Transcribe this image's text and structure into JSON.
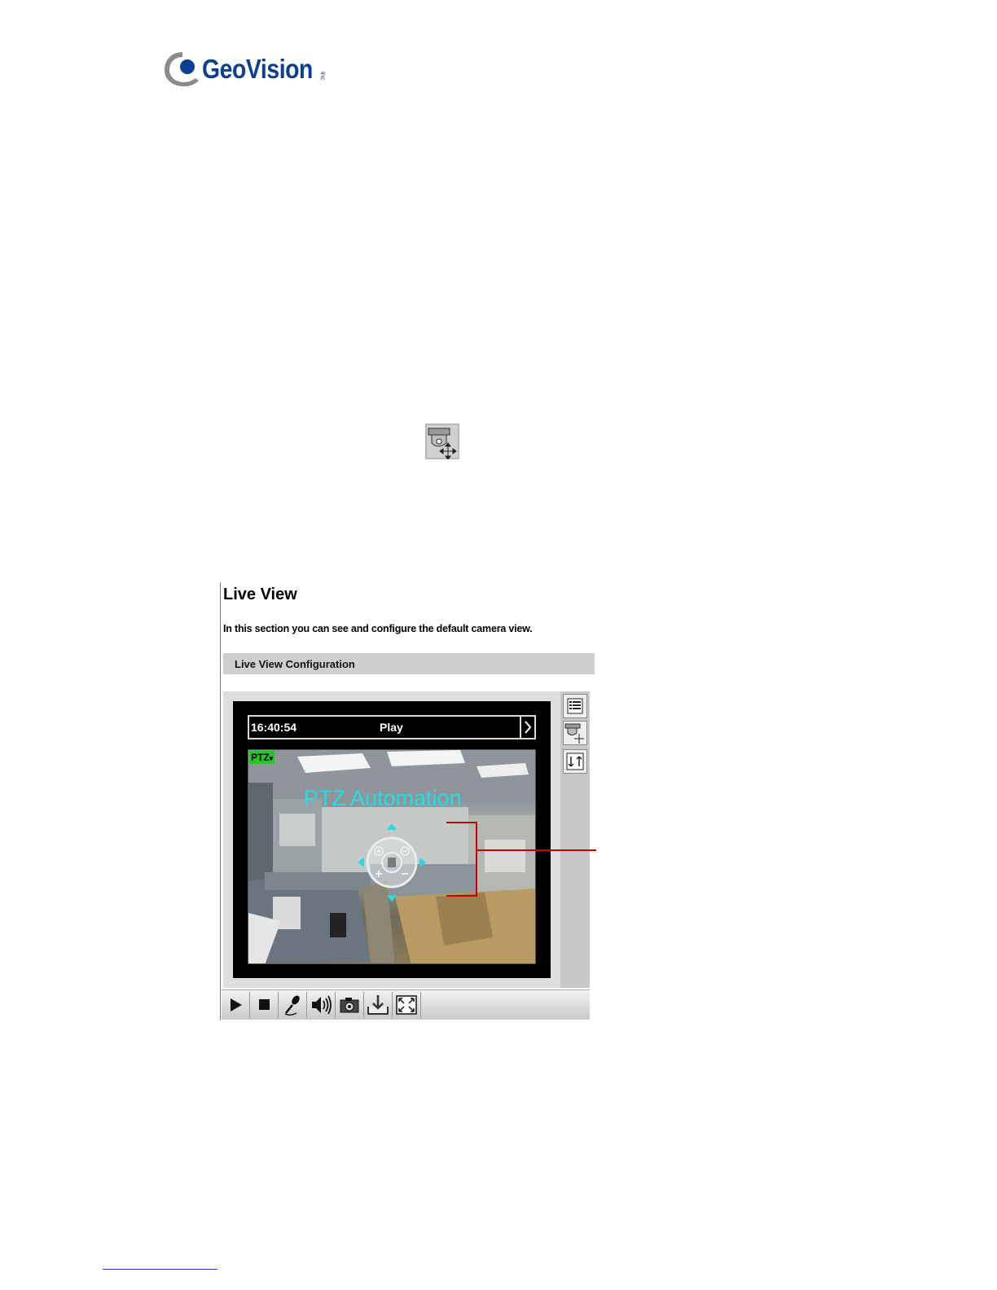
{
  "brand": {
    "name": "GeoVision",
    "suffix": "inc",
    "colors": {
      "primary": "#0b3f8f",
      "swoosh": "#8a8a8a"
    }
  },
  "inline_icon": "ptz-control-icon",
  "live_view": {
    "title": "Live View",
    "description": "In this section you can see and configure the default camera view.",
    "section_header": "Live View Configuration",
    "status": {
      "time": "16:40:54",
      "mode": "Play"
    },
    "ptz_tag": "PTZ",
    "ptz_tag_arrow": "▾",
    "overlay_label": "PTZ Automation",
    "side_buttons": [
      "settings-list-icon",
      "ptz-control-icon",
      "io-control-icon"
    ],
    "toolbar_buttons": [
      "play-icon",
      "stop-icon",
      "microphone-icon",
      "speaker-icon",
      "snapshot-icon",
      "download-icon",
      "fullscreen-icon"
    ],
    "colors": {
      "overlay": "#1ee1e6",
      "ptz_tag": "#22c822",
      "callout": "#cc0000"
    }
  }
}
